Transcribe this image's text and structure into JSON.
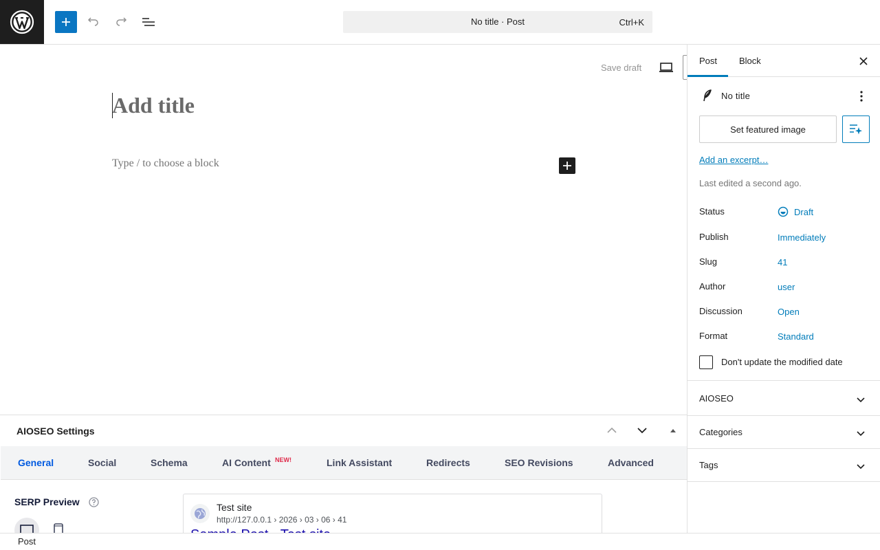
{
  "header": {
    "command_bar": {
      "title": "No title · Post",
      "shortcut": "Ctrl+K"
    },
    "icons": {
      "logo": "wordpress-logo-icon",
      "add": "plus-icon",
      "undo": "undo-icon",
      "redo": "redo-icon",
      "list_view": "document-overview-icon"
    }
  },
  "editor": {
    "save_draft": "Save draft",
    "title_placeholder": "Add title",
    "block_placeholder": "Type / to choose a block"
  },
  "metabox": {
    "title": "AIOSEO Settings",
    "tabs": [
      {
        "label": "General",
        "active": true
      },
      {
        "label": "Social"
      },
      {
        "label": "Schema"
      },
      {
        "label": "AI Content",
        "badge": "NEW!"
      },
      {
        "label": "Link Assistant"
      },
      {
        "label": "Redirects"
      },
      {
        "label": "SEO Revisions"
      },
      {
        "label": "Advanced"
      }
    ],
    "serp": {
      "label": "SERP Preview",
      "site_name": "Test site",
      "url": "http://127.0.0.1 › 2026 › 03 › 06 › 41",
      "headline": "Sample Post - Test site"
    }
  },
  "sidebar": {
    "tabs": [
      {
        "label": "Post",
        "active": true
      },
      {
        "label": "Block"
      }
    ],
    "post_title": "No title",
    "featured_image_button": "Set featured image",
    "excerpt_link": "Add an excerpt…",
    "last_edited": "Last edited a second ago.",
    "properties": [
      {
        "label": "Status",
        "value": "Draft"
      },
      {
        "label": "Publish",
        "value": "Immediately"
      },
      {
        "label": "Slug",
        "value": "41"
      },
      {
        "label": "Author",
        "value": "user"
      },
      {
        "label": "Discussion",
        "value": "Open"
      },
      {
        "label": "Format",
        "value": "Standard"
      }
    ],
    "modified_date_checkbox": {
      "label": "Don't update the modified date",
      "checked": false
    },
    "panels": [
      {
        "label": "AIOSEO"
      },
      {
        "label": "Categories"
      },
      {
        "label": "Tags"
      }
    ]
  },
  "footer": {
    "breadcrumb": "Post"
  },
  "colors": {
    "accent": "#007cba",
    "primary_button": "#0a76c2",
    "aioseo_active_tab": "#005ae0",
    "badge": "#df2a4a"
  }
}
